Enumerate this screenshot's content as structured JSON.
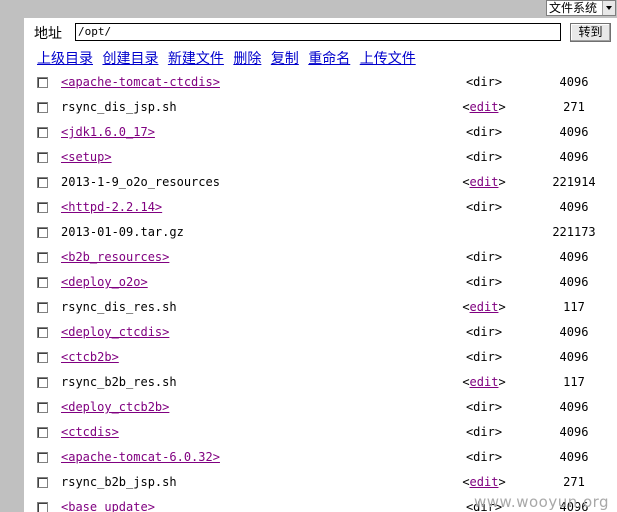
{
  "top": {
    "select_value": "文件系统"
  },
  "address": {
    "label": "地址",
    "value": "/opt/",
    "go_label": "转到"
  },
  "actions": [
    "上级目录",
    "创建目录",
    "新建文件",
    "删除",
    "复制",
    "重命名",
    "上传文件"
  ],
  "files": [
    {
      "name": "<apache-tomcat-ctcdis>",
      "kind": "dir",
      "type": "<dir>",
      "size": "4096"
    },
    {
      "name": "rsync_dis_jsp.sh",
      "kind": "file",
      "type": "<edit>",
      "size": "271"
    },
    {
      "name": "<jdk1.6.0_17>",
      "kind": "dir",
      "type": "<dir>",
      "size": "4096"
    },
    {
      "name": "<setup>",
      "kind": "dir",
      "type": "<dir>",
      "size": "4096"
    },
    {
      "name": "2013-1-9_o2o_resources",
      "kind": "file",
      "type": "<edit>",
      "size": "221914"
    },
    {
      "name": "<httpd-2.2.14>",
      "kind": "dir",
      "type": "<dir>",
      "size": "4096"
    },
    {
      "name": "2013-01-09.tar.gz",
      "kind": "file",
      "type": "",
      "size": "221173"
    },
    {
      "name": "<b2b_resources>",
      "kind": "dir",
      "type": "<dir>",
      "size": "4096"
    },
    {
      "name": "<deploy_o2o>",
      "kind": "dir",
      "type": "<dir>",
      "size": "4096"
    },
    {
      "name": "rsync_dis_res.sh",
      "kind": "file",
      "type": "<edit>",
      "size": "117"
    },
    {
      "name": "<deploy_ctcdis>",
      "kind": "dir",
      "type": "<dir>",
      "size": "4096"
    },
    {
      "name": "<ctcb2b>",
      "kind": "dir",
      "type": "<dir>",
      "size": "4096"
    },
    {
      "name": "rsync_b2b_res.sh",
      "kind": "file",
      "type": "<edit>",
      "size": "117"
    },
    {
      "name": "<deploy_ctcb2b>",
      "kind": "dir",
      "type": "<dir>",
      "size": "4096"
    },
    {
      "name": "<ctcdis>",
      "kind": "dir",
      "type": "<dir>",
      "size": "4096"
    },
    {
      "name": "<apache-tomcat-6.0.32>",
      "kind": "dir",
      "type": "<dir>",
      "size": "4096"
    },
    {
      "name": "rsync_b2b_jsp.sh",
      "kind": "file",
      "type": "<edit>",
      "size": "271"
    },
    {
      "name": "<base_update>",
      "kind": "dir",
      "type": "<dir>",
      "size": "4096"
    }
  ],
  "watermark": "www.wooyun.org",
  "colors": {
    "link": "#0000cc",
    "visited": "#800080",
    "background": "#c0c0c0"
  }
}
